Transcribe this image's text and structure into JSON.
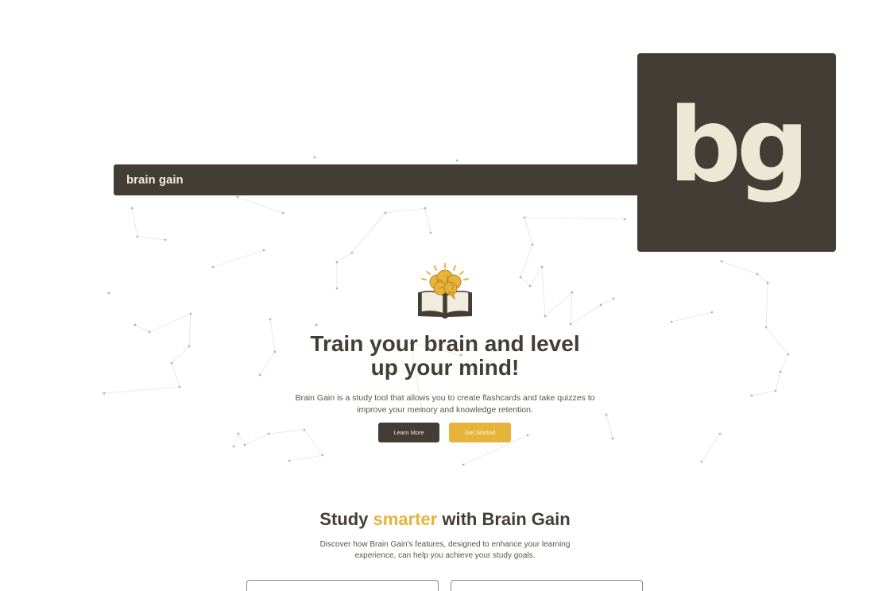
{
  "navbar": {
    "brand": "brain gain"
  },
  "logo": {
    "text": "bg"
  },
  "hero": {
    "icon": "brain-book-icon",
    "title_line1": "Train your brain and level",
    "title_line2": "up your mind!",
    "subtitle_line1": "Brain Gain is a study tool that allows you to create flashcards and take quizzes to",
    "subtitle_line2": "improve your memory and knowledge retention.",
    "learn_more": "Learn More",
    "get_started": "Get Started"
  },
  "features": {
    "title_before": "Study ",
    "title_accent": "smarter",
    "title_after": " with Brain Gain",
    "subtitle_line1": "Discover how Brain Gain's features, designed to enhance your learning",
    "subtitle_line2": "experience, can help you achieve your study goals."
  },
  "colors": {
    "dark": "#433d35",
    "accent": "#e6b33b",
    "cream": "#f1ecdd",
    "background": "#ffffff"
  }
}
